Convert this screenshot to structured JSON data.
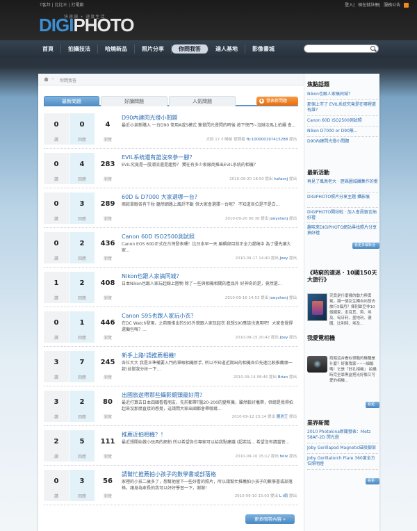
{
  "topbar": {
    "left_links": [
      "T客邦",
      "比比王",
      "打電動"
    ],
    "right_links": [
      "登入",
      "現在就註冊",
      "服務公告"
    ]
  },
  "logo": {
    "tagline": "快速讀 • 速度生活",
    "brand_a": "DIGI",
    "brand_b": "PHOTO"
  },
  "nav": {
    "items": [
      "首頁",
      "拍攝技法",
      "哈燒新品",
      "照片分享",
      "你問我答",
      "達人基地",
      "影像書城"
    ]
  },
  "search": {
    "placeholder": ""
  },
  "breadcrumb": {
    "current": "你問我答"
  },
  "tabs": [
    "最新問題",
    "好讀問題",
    "人氣問題"
  ],
  "ask_button": "發表新問題",
  "labels": {
    "vote": "讚",
    "answers": "回應",
    "views": "瀏覽"
  },
  "questions": [
    {
      "votes": "0",
      "answers": "0",
      "views": "4",
      "title": "D90內建閃光燈小問題",
      "excerpt": "最近小弟新購入 一台D90 常用A或S模式  簽覺閃光燈閃的時後 按下快門~沒辦法馬上拍攝 會...",
      "time": "大約 17 小時前 提問者",
      "user": "fb:100000197415288",
      "suffix": "提出"
    },
    {
      "votes": "0",
      "answers": "4",
      "views": "283",
      "title": "EVIL系統還有誰沒來參一腳？",
      "excerpt": "EVIL究竟是一股潮流還是趨勢？ 獨在有多少家廠商推出EVIL系統的相機？",
      "time": "2010-09-20 18:50 提出",
      "user": "hafasnj",
      "suffix": "提出"
    },
    {
      "votes": "0",
      "answers": "3",
      "views": "289",
      "title": "60D & D7000 大家選哪一台?",
      "excerpt": "兩款單眼各有千秋 廳然網路上風評不斷 但大家會選擇一台呢？ 不知道各位是不是白...",
      "time": "2010-09-20 00:30 提出",
      "user": "joeyshenj",
      "suffix": "提出"
    },
    {
      "votes": "0",
      "answers": "2",
      "views": "436",
      "title": "Canon 60D ISO2500測試照",
      "excerpt": "Canon EOS 60D正式在台灣發表嘍！比日本早一天 編輯部目前正全力趕稿中 為了優先讓大家...",
      "time": "2010-09-17 14:40 提出",
      "user": "Joey",
      "suffix": "提出"
    },
    {
      "votes": "1",
      "answers": "2",
      "views": "408",
      "title": "Nikon也跟人家搞同城？",
      "excerpt": "日本Nikon也跟人家玩起線上圖物 除了一些與相機相關的產品外 好神奇的是，竟然還...",
      "time": "2010-09-16 14:53 提出",
      "user": "joeyshenj",
      "suffix": "提出"
    },
    {
      "votes": "0",
      "answers": "1",
      "views": "446",
      "title": "Canon S95也跟人家玩小衣？",
      "excerpt": "在DC Watch發現，之前剛推出的S95外貌跟人家玩起衣 我想S90應該也適用吧！大家會覺得還顯包嗎？...",
      "time": "2010-09-15 20:42 提出",
      "user": "Joey",
      "suffix": "提出"
    },
    {
      "votes": "3",
      "answers": "7",
      "views": "245",
      "title": "新手上路!請推薦相機!",
      "excerpt": "各位大大 我是正準備要入門的單眼相機新手, 所以不知道近期出的相機各位先進比較推薦哪一款!並幫我分析一下...",
      "time": "2010-09-14 08:46 提出",
      "user": "Brian",
      "suffix": "提出"
    },
    {
      "votes": "3",
      "answers": "2",
      "views": "80",
      "title": "出國旅遊帶那些攝影鏡頭最好用？",
      "excerpt": "最近打算去日本四國看看朋友，先前都帶T腦20-200的變焦機，雖然較好攜帶，但總是覺得拍起來沒那麼直接的感覺，這請問大家出國都會帶哪幾...",
      "time": "2010-09-12 23:14 提出",
      "user": "圖池王",
      "suffix": "提出"
    },
    {
      "votes": "2",
      "answers": "5",
      "views": "111",
      "title": "推薦近拍相機？！",
      "excerpt": "最近想開始做小玩具的網拍  所以希望各位專家可以給我點建議 (超若話... 希望沒有請當答...",
      "time": "2010-09-10 15:12 提出",
      "user": "felix",
      "suffix": "提出"
    },
    {
      "votes": "0",
      "answers": "3",
      "views": "56",
      "title": "請幫忙推薦拍小孩子的數學書或部落格",
      "excerpt": "家裡的小孩二歲多了，想幫他留下一些好看的照片，所以請幫忙推薦拍小孩子的數學書或部落格，讓身為家長的我可以好好學習一下，謝謝！",
      "time": "2010-09-10 15:03 提出",
      "user": "L.t肩",
      "suffix": "提出"
    }
  ],
  "more_questions": "更多問答內容 »",
  "sidebar": {
    "hot_title": "焦點話題",
    "hot_links": [
      "Nikon也跟人家搞同城？",
      "那個上市了 EVIL系統究竟是在哪裡還有誰？",
      "Canon 60D ISO2500測試照",
      "Nikon D7000 or D90無...",
      "D90內建閃光燈小問題"
    ],
    "events_title": "最新活動",
    "events_links": [
      "再見了風鳥老大 · 歷碼圖城攝集作的愛",
      "DIGIPHOTO照片分享主題  攝影展",
      "DIGIPHOTO開站啦 · 加入會員留言抽好禮",
      "趣味來DIGIPHOTO網站尋找照片分享抽好禮"
    ],
    "events_more": "看更多最新活動",
    "book_title": "《時窮的速迷 · 10國150天大旅行》",
    "book_desc": "究竟是什麼樣的動力與勇氣，讓一個女生獨自出發去旅行5個月？揮別歐亞非10個國家，走耳其、剪、埃及、匈牙利、墨地利、德國、比利時、埃及...",
    "camera_title": "我愛霓相機",
    "camera_desc": "請隨這台看似很酷的機種是什麼？好像我家~~~細膩嗎！它是「針孔相機」  拍攝時完全靠黑盒把光好像又可愛的相機...",
    "camera_more": "看更多",
    "news_title": "業界新聞",
    "news_links": [
      "2010 Photokina新聞發表：Metz 58AF-2D 閃光燈",
      "Joby Gorillapod Magnetic磁吸腳架",
      "Joby Gorillatorch Flare  360度全方位照明燈",
      "..."
    ],
    "news_more": "看更多"
  },
  "colors": {
    "accent": "#2a6bb0",
    "nav_bg": "#26313c",
    "button_orange": "#e86d0e",
    "tab_blue": "#4d8bc3"
  }
}
